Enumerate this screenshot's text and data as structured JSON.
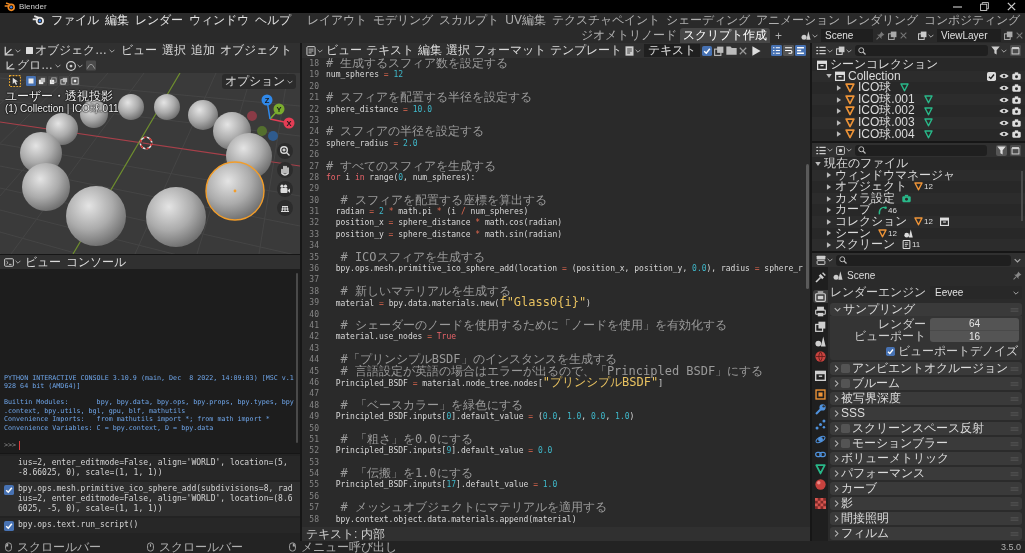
{
  "title_bar": {
    "title": "Blender"
  },
  "top_bar": {
    "menus": [
      "ファイル",
      "編集",
      "レンダー",
      "ウィンドウ",
      "ヘルプ"
    ],
    "workspaces": [
      {
        "label": "レイアウト",
        "selected": false
      },
      {
        "label": "モデリング",
        "selected": false
      },
      {
        "label": "スカルプト",
        "selected": false
      },
      {
        "label": "UV編集",
        "selected": false
      },
      {
        "label": "テクスチャペイント",
        "selected": false
      },
      {
        "label": "シェーディング",
        "selected": false
      },
      {
        "label": "アニメーション",
        "selected": false
      },
      {
        "label": "レンダリング",
        "selected": false
      },
      {
        "label": "コンポジティング",
        "selected": false
      },
      {
        "label": "ジオメトリノード",
        "selected": false
      },
      {
        "label": "スクリプト作成",
        "selected": true
      }
    ],
    "add_tab": "+",
    "scene": "Scene",
    "view_layer": "ViewLayer"
  },
  "viewport": {
    "mode": "オブジェク…",
    "menus": [
      "ビュー",
      "選択",
      "追加",
      "オブジェクト"
    ],
    "orientation": "グロ…",
    "select_modes": [
      {
        "selected": true
      },
      {
        "selected": false
      },
      {
        "selected": false
      },
      {
        "selected": false
      },
      {
        "selected": false
      }
    ],
    "options": "オプション",
    "view_name": "ユーザー・透視投影",
    "active_info": "(1) Collection | ICO球.011",
    "gizmo": [
      {
        "kind": "x",
        "label": "X"
      },
      {
        "kind": "y",
        "label": "Y"
      },
      {
        "kind": "z",
        "label": "Z"
      }
    ],
    "spheres": [
      {
        "selected": false
      },
      {
        "selected": false
      },
      {
        "selected": false
      },
      {
        "selected": false
      },
      {
        "selected": false
      },
      {
        "selected": false
      },
      {
        "selected": true
      },
      {
        "selected": false
      },
      {
        "selected": false
      },
      {
        "selected": false
      },
      {
        "selected": false
      },
      {
        "selected": false
      }
    ]
  },
  "console": {
    "menus": [
      "ビュー",
      "コンソール"
    ],
    "output": [
      {
        "lines": [
          "PYTHON INTERACTIVE CONSOLE 3.10.9 (main, Dec  8 2022, 14:09:03) [MSC v.1",
          "928 64 bit (AMD64)]"
        ]
      }
    ],
    "banner": [
      {
        "lines": [
          "Builtin Modules:       bpy, bpy.data, bpy.ops, bpy.props, bpy.types, bpy",
          ".context, bpy.utils, bgl, gpu, blf, mathutils"
        ]
      },
      {
        "lines": [
          "Convenience Imports:   from mathutils import *; from math import *"
        ]
      },
      {
        "lines": [
          "Convenience Variables: C = bpy.context, D = bpy.data"
        ]
      }
    ],
    "prompt": ">>>"
  },
  "info": {
    "reports": [
      {
        "icon_visible": false,
        "lines": [
          "ius=2, enter_editmode=False, align='WORLD', location=(5,",
          "-8.66025, 0), scale=(1, 1, 1))"
        ]
      },
      {
        "icon_visible": true,
        "lines": [
          "bpy.ops.mesh.primitive_ico_sphere_add(subdivisions=8, rad",
          "ius=2, enter_editmode=False, align='WORLD', location=(8.6",
          "6025, -5, 0), scale=(1, 1, 1))"
        ]
      },
      {
        "icon_visible": true,
        "lines": [
          "bpy.ops.text.run_script()"
        ]
      }
    ]
  },
  "text_editor": {
    "menus": [
      "ビュー",
      "テキスト",
      "編集",
      "選択",
      "フォーマット",
      "テンプレート"
    ],
    "text_name": "テキスト",
    "fake_user": true,
    "view_toggles": [
      {
        "kind": "line_numbers",
        "on": true
      },
      {
        "kind": "word_wrap",
        "on": false
      },
      {
        "kind": "syntax",
        "on": true
      }
    ],
    "lines": [
      {
        "number": "18",
        "tokens": [
          {
            "text": "# 生成するスフィア数を設定する",
            "kind": "comment"
          }
        ]
      },
      {
        "number": "19",
        "tokens": [
          {
            "text": "num_spheres",
            "kind": "plain"
          },
          {
            "text": " = ",
            "kind": "operator"
          },
          {
            "text": "12",
            "kind": "number"
          }
        ]
      },
      {
        "number": "20"
      },
      {
        "number": "21",
        "tokens": [
          {
            "text": "# スフィアを配置する半径を設定する",
            "kind": "comment"
          }
        ]
      },
      {
        "number": "22",
        "tokens": [
          {
            "text": "sphere_distance",
            "kind": "plain"
          },
          {
            "text": " = ",
            "kind": "operator"
          },
          {
            "text": "10.0",
            "kind": "number"
          }
        ]
      },
      {
        "number": "23"
      },
      {
        "number": "24",
        "tokens": [
          {
            "text": "# スフィアの半径を設定する",
            "kind": "comment"
          }
        ]
      },
      {
        "number": "25",
        "tokens": [
          {
            "text": "sphere_radius",
            "kind": "plain"
          },
          {
            "text": " = ",
            "kind": "operator"
          },
          {
            "text": "2.0",
            "kind": "number"
          }
        ]
      },
      {
        "number": "26"
      },
      {
        "number": "27",
        "tokens": [
          {
            "text": "# すべてのスフィアを生成する",
            "kind": "comment"
          }
        ]
      },
      {
        "number": "28",
        "tokens": [
          {
            "text": "for",
            "kind": "keyword"
          },
          {
            "text": " i ",
            "kind": "plain"
          },
          {
            "text": "in",
            "kind": "keyword"
          },
          {
            "text": " range(",
            "kind": "plain"
          },
          {
            "text": "0",
            "kind": "number"
          },
          {
            "text": ", num_spheres):",
            "kind": "plain"
          }
        ]
      },
      {
        "number": "29"
      },
      {
        "number": "30",
        "tokens": [
          {
            "text": "  # スフィアを配置する座標を算出する",
            "kind": "comment"
          }
        ]
      },
      {
        "number": "31",
        "tokens": [
          {
            "text": "  radian",
            "kind": "plain"
          },
          {
            "text": " = ",
            "kind": "operator"
          },
          {
            "text": "2",
            "kind": "number"
          },
          {
            "text": " * ",
            "kind": "operator"
          },
          {
            "text": "math.pi",
            "kind": "plain"
          },
          {
            "text": " * ",
            "kind": "operator"
          },
          {
            "text": "(i",
            "kind": "plain"
          },
          {
            "text": " / ",
            "kind": "operator"
          },
          {
            "text": "num_spheres)",
            "kind": "plain"
          }
        ]
      },
      {
        "number": "32",
        "tokens": [
          {
            "text": "  position_x",
            "kind": "plain"
          },
          {
            "text": " = ",
            "kind": "operator"
          },
          {
            "text": "sphere_distance",
            "kind": "plain"
          },
          {
            "text": " * ",
            "kind": "operator"
          },
          {
            "text": "math.cos(radian)",
            "kind": "plain"
          }
        ]
      },
      {
        "number": "33",
        "tokens": [
          {
            "text": "  position_y",
            "kind": "plain"
          },
          {
            "text": " = ",
            "kind": "operator"
          },
          {
            "text": "sphere_distance",
            "kind": "plain"
          },
          {
            "text": " * ",
            "kind": "operator"
          },
          {
            "text": "math.sin(radian)",
            "kind": "plain"
          }
        ]
      },
      {
        "number": "34"
      },
      {
        "number": "35",
        "tokens": [
          {
            "text": "  # ICOスフィアを生成する",
            "kind": "comment"
          }
        ]
      },
      {
        "number": "36",
        "tokens": [
          {
            "text": "  bpy.ops.mesh.primitive_ico_sphere_add(location",
            "kind": "plain"
          },
          {
            "text": " = ",
            "kind": "operator"
          },
          {
            "text": "(position_x, position_y, ",
            "kind": "plain"
          },
          {
            "text": "0.0",
            "kind": "number"
          },
          {
            "text": "), radius",
            "kind": "plain"
          },
          {
            "text": " = ",
            "kind": "operator"
          },
          {
            "text": "sphere_r",
            "kind": "plain"
          }
        ]
      },
      {
        "number": "37"
      },
      {
        "number": "38",
        "tokens": [
          {
            "text": "  # 新しいマテリアルを生成する",
            "kind": "comment"
          }
        ]
      },
      {
        "number": "39",
        "tokens": [
          {
            "text": "  material",
            "kind": "plain"
          },
          {
            "text": " = ",
            "kind": "operator"
          },
          {
            "text": "bpy.data.materials.new(",
            "kind": "plain"
          },
          {
            "text": "f\"Glass0{i}\"",
            "kind": "string"
          },
          {
            "text": ")",
            "kind": "plain"
          }
        ]
      },
      {
        "number": "40"
      },
      {
        "number": "41",
        "tokens": [
          {
            "text": "  # シェーダーのノードを使用するために「ノードを使用」を有効化する",
            "kind": "comment"
          }
        ]
      },
      {
        "number": "42",
        "tokens": [
          {
            "text": "  material.use_nodes",
            "kind": "plain"
          },
          {
            "text": " = ",
            "kind": "operator"
          },
          {
            "text": "True",
            "kind": "keyword"
          }
        ]
      },
      {
        "number": "43"
      },
      {
        "number": "44",
        "tokens": [
          {
            "text": "  #「プリンシプルBSDF」のインスタンスを生成する",
            "kind": "comment"
          }
        ]
      },
      {
        "number": "45",
        "tokens": [
          {
            "text": "  # 言語設定が英語の場合はエラーが出るので、「Principled BSDF」にする",
            "kind": "comment"
          }
        ]
      },
      {
        "number": "46",
        "tokens": [
          {
            "text": "  Principled_BSDF",
            "kind": "plain"
          },
          {
            "text": " = ",
            "kind": "operator"
          },
          {
            "text": "material.node_tree.nodes[",
            "kind": "plain"
          },
          {
            "text": "\"プリンシプルBSDF\"",
            "kind": "string"
          },
          {
            "text": "]",
            "kind": "plain"
          }
        ]
      },
      {
        "number": "47"
      },
      {
        "number": "48",
        "tokens": [
          {
            "text": "  # 「ベースカラー」を緑色にする",
            "kind": "comment"
          }
        ]
      },
      {
        "number": "49",
        "tokens": [
          {
            "text": "  Principled_BSDF.inputs[",
            "kind": "plain"
          },
          {
            "text": "0",
            "kind": "number"
          },
          {
            "text": "].default_value",
            "kind": "plain"
          },
          {
            "text": " = ",
            "kind": "operator"
          },
          {
            "text": "(",
            "kind": "plain"
          },
          {
            "text": "0.0",
            "kind": "number"
          },
          {
            "text": ", ",
            "kind": "plain"
          },
          {
            "text": "1.0",
            "kind": "number"
          },
          {
            "text": ", ",
            "kind": "plain"
          },
          {
            "text": "0.0",
            "kind": "number"
          },
          {
            "text": ", ",
            "kind": "plain"
          },
          {
            "text": "1.0",
            "kind": "number"
          },
          {
            "text": ")",
            "kind": "plain"
          }
        ]
      },
      {
        "number": "50"
      },
      {
        "number": "51",
        "tokens": [
          {
            "text": "  # 「粗さ」を0.0にする",
            "kind": "comment"
          }
        ]
      },
      {
        "number": "52",
        "tokens": [
          {
            "text": "  Principled_BSDF.inputs[",
            "kind": "plain"
          },
          {
            "text": "9",
            "kind": "number"
          },
          {
            "text": "].default_value",
            "kind": "plain"
          },
          {
            "text": " = ",
            "kind": "operator"
          },
          {
            "text": "0.0",
            "kind": "number"
          }
        ]
      },
      {
        "number": "53"
      },
      {
        "number": "54",
        "tokens": [
          {
            "text": "  # 「伝搬」を1.0にする",
            "kind": "comment"
          }
        ]
      },
      {
        "number": "55",
        "tokens": [
          {
            "text": "  Principled_BSDF.inputs[",
            "kind": "plain"
          },
          {
            "text": "17",
            "kind": "number"
          },
          {
            "text": "].default_value",
            "kind": "plain"
          },
          {
            "text": " = ",
            "kind": "operator"
          },
          {
            "text": "1.0",
            "kind": "number"
          }
        ]
      },
      {
        "number": "56"
      },
      {
        "number": "57",
        "tokens": [
          {
            "text": "  # メッシュオブジェクトにマテリアルを適用する",
            "kind": "comment"
          }
        ]
      },
      {
        "number": "58",
        "tokens": [
          {
            "text": "  bpy.context.object.data.materials.append(material)",
            "kind": "plain"
          }
        ]
      }
    ],
    "footer": "テキスト: 内部"
  },
  "outliner": {
    "tree": [
      {
        "name": "シーンコレクション",
        "children": [
          {
            "name": "Collection",
            "expanded": true,
            "checked": true,
            "children": [
              {
                "name": "ICO球",
                "expanded": false
              },
              {
                "name": "ICO球.001",
                "expanded": false
              },
              {
                "name": "ICO球.002",
                "expanded": false
              },
              {
                "name": "ICO球.003",
                "expanded": false
              },
              {
                "name": "ICO球.004",
                "expanded": false
              }
            ]
          }
        ]
      }
    ]
  },
  "file_outliner": {
    "tree": [
      {
        "name": "現在のファイル",
        "expanded": true,
        "children": [
          {
            "name": "ウィンドウマネージャ",
            "expanded": false
          },
          {
            "name": "オブジェクト",
            "expanded": false,
            "badges": [
              {
                "kind": "object",
                "count": "12"
              }
            ]
          },
          {
            "name": "カメラ設定",
            "expanded": false,
            "badges": [
              {
                "kind": "camera"
              }
            ]
          },
          {
            "name": "カーブ",
            "expanded": false,
            "badges": [
              {
                "kind": "curve",
                "count": "46"
              }
            ]
          },
          {
            "name": "コレクション",
            "expanded": false,
            "badges": [
              {
                "kind": "object",
                "count": "12"
              },
              {
                "kind": "collection"
              }
            ]
          },
          {
            "name": "シーン",
            "expanded": false,
            "badges": [
              {
                "kind": "object",
                "count": "12"
              },
              {
                "kind": "scene"
              }
            ]
          },
          {
            "name": "スクリーン",
            "expanded": false,
            "badges": [
              {
                "kind": "screen",
                "count": "11"
              }
            ]
          }
        ]
      }
    ]
  },
  "properties": {
    "tab_groups": [
      [
        {
          "kind": "tool",
          "selected": false
        }
      ],
      [
        {
          "kind": "render",
          "selected": true
        },
        {
          "kind": "output",
          "selected": false
        },
        {
          "kind": "view_layer",
          "selected": false
        },
        {
          "kind": "scene",
          "selected": false
        },
        {
          "kind": "world",
          "selected": false
        }
      ],
      [
        {
          "kind": "collection",
          "selected": false
        }
      ],
      [
        {
          "kind": "object",
          "selected": false
        },
        {
          "kind": "modifiers",
          "selected": false
        },
        {
          "kind": "particles",
          "selected": false
        },
        {
          "kind": "physics",
          "selected": false
        },
        {
          "kind": "constraints",
          "selected": false
        },
        {
          "kind": "data",
          "selected": false
        },
        {
          "kind": "material",
          "selected": false
        }
      ],
      [
        {
          "kind": "texture",
          "selected": false
        }
      ]
    ],
    "context": "Scene",
    "render_engine": {
      "label": "レンダーエンジン",
      "value": "Eevee"
    },
    "panels": [
      {
        "title": "サンプリング",
        "expanded": true,
        "fields": [
          {
            "label": "レンダー",
            "value": "64"
          },
          {
            "label": "ビューポート",
            "value": "16"
          }
        ],
        "options": [
          {
            "label": "ビューポートデノイズ",
            "checked": true
          }
        ]
      },
      {
        "title": "アンビエントオクルージョン",
        "expanded": false,
        "checked": false
      },
      {
        "title": "ブルーム",
        "expanded": false,
        "checked": false
      },
      {
        "title": "被写界深度",
        "expanded": false
      },
      {
        "title": "SSS",
        "expanded": false
      },
      {
        "title": "スクリーンスペース反射",
        "expanded": false,
        "checked": false
      },
      {
        "title": "モーションブラー",
        "expanded": false,
        "checked": false
      },
      {
        "title": "ボリューメトリック",
        "expanded": false
      },
      {
        "title": "パフォーマンス",
        "expanded": false
      },
      {
        "title": "カーブ",
        "expanded": false
      },
      {
        "title": "影",
        "expanded": false
      },
      {
        "title": "間接照明",
        "expanded": false
      },
      {
        "title": "フィルム",
        "expanded": false
      }
    ]
  },
  "status_bar": {
    "hints": [
      {
        "kind": "left",
        "text": "スクロールバー"
      },
      {
        "kind": "middle",
        "text": "スクロールバー"
      },
      {
        "kind": "right",
        "text": "メニュー呼び出し"
      }
    ],
    "version": "3.5.0"
  }
}
